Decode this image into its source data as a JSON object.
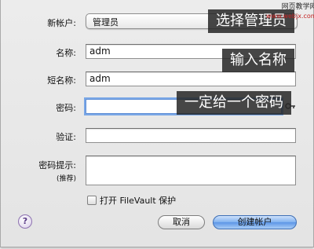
{
  "form": {
    "account_type_label": "新帐户:",
    "account_type_value": "管理员",
    "name_label": "名称:",
    "name_value": "adm",
    "short_name_label": "短名称:",
    "short_name_value": "adm",
    "password_label": "密码:",
    "password_value": "",
    "verify_label": "验证:",
    "verify_value": "",
    "hint_label": "密码提示:",
    "hint_sublabel": "(推荐)",
    "hint_value": "",
    "filevault_label": "打开 FileVault 保护"
  },
  "buttons": {
    "help": "?",
    "cancel": "取消",
    "create": "创建帐户"
  },
  "annotations": {
    "select": "选择管理员",
    "name": "输入名称",
    "password": "一定给一个密码"
  },
  "watermark": {
    "line1": "网页教学网",
    "line2": "www.webjx.com"
  },
  "icons": {
    "key": "key-icon",
    "help": "help-icon",
    "checkbox": "checkbox-icon"
  }
}
